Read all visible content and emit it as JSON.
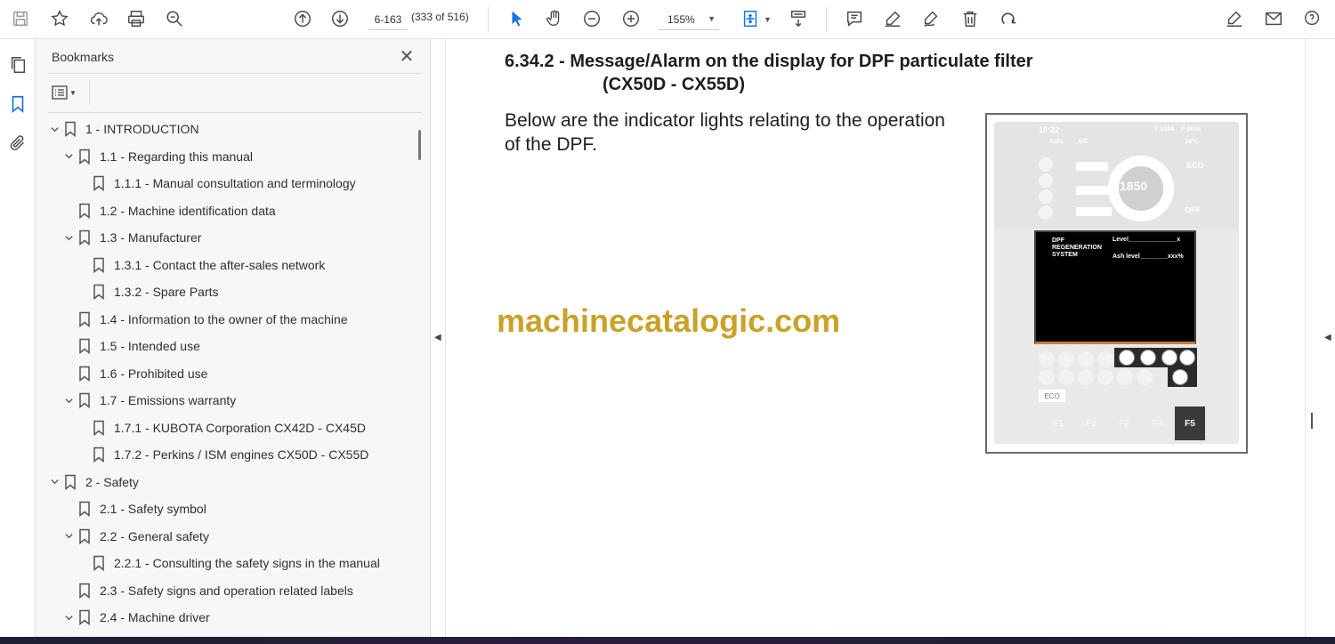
{
  "toolbar": {
    "page_value": "6-163",
    "page_count": "(333 of 516)",
    "zoom_value": "155%"
  },
  "panel": {
    "title": "Bookmarks",
    "items": [
      {
        "label": "1  -  INTRODUCTION",
        "level": 0,
        "expanded": true
      },
      {
        "label": "1.1 - Regarding this manual",
        "level": 1,
        "expanded": true
      },
      {
        "label": "1.1.1 - Manual consultation and terminology",
        "level": 2
      },
      {
        "label": "1.2 - Machine identification data",
        "level": 1
      },
      {
        "label": "1.3 - Manufacturer",
        "level": 1,
        "expanded": true
      },
      {
        "label": "1.3.1 - Contact the after-sales network",
        "level": 2
      },
      {
        "label": "1.3.2 - Spare Parts",
        "level": 2
      },
      {
        "label": "1.4 - Information to the owner of the machine",
        "level": 1
      },
      {
        "label": "1.5 - Intended use",
        "level": 1
      },
      {
        "label": "1.6 - Prohibited use",
        "level": 1
      },
      {
        "label": "1.7 - Emissions warranty",
        "level": 1,
        "expanded": true
      },
      {
        "label": "1.7.1 - KUBOTA Corporation CX42D - CX45D",
        "level": 2
      },
      {
        "label": "1.7.2 - Perkins / ISM engines CX50D - CX55D",
        "level": 2
      },
      {
        "label": "2  -  Safety",
        "level": 0,
        "expanded": true
      },
      {
        "label": "2.1 - Safety symbol",
        "level": 1
      },
      {
        "label": "2.2 - General safety",
        "level": 1,
        "expanded": true
      },
      {
        "label": "2.2.1 - Consulting the safety signs in the manual",
        "level": 2
      },
      {
        "label": "2.3 - Safety signs and operation related labels",
        "level": 1
      },
      {
        "label": "2.4 - Machine driver",
        "level": 1,
        "expanded": true
      }
    ]
  },
  "document": {
    "heading_line1": "6.34.2 - Message/Alarm on the display for DPF particulate filter",
    "heading_line2": "(CX50D - CX55D)",
    "body_line1": "Below are the indicator lights relating to the operation",
    "body_line2": "of the DPF.",
    "watermark": "machinecatalogic.com"
  },
  "display": {
    "time": "10:22",
    "t_value": "T 1034",
    "p_value": "P 0006",
    "auto_label": "Auto",
    "ac_label": "A/C",
    "temp": "14°C",
    "rpm": "1850",
    "eco_label": "ECO",
    "off_label": "OFF",
    "screen_line1": "DPF",
    "screen_line2": "REGENERATION",
    "screen_line3": "SYSTEM",
    "level_label": "Level______________x",
    "ash_label": "Ash level________xxx%",
    "eco_button": "ECO",
    "fkeys": [
      "F1",
      "F2",
      "F3",
      "F4",
      "F5"
    ],
    "active_fkey": "F5"
  },
  "colors": {
    "accent": "#1473e6",
    "watermark": "#c9a227"
  }
}
